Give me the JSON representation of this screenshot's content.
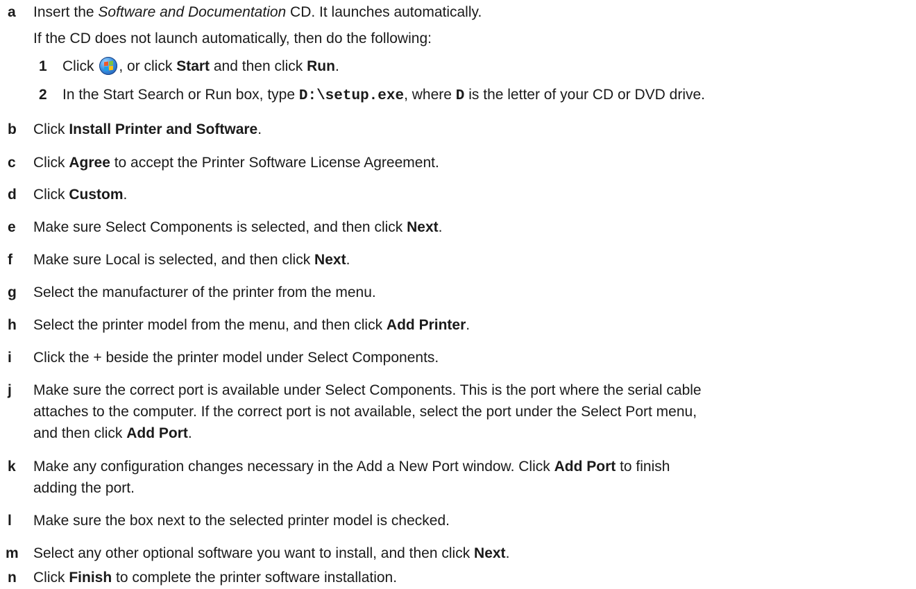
{
  "steps": {
    "a": {
      "letter": "a",
      "t1": "Insert the ",
      "t2": "Software and Documentation",
      "t3": " CD. It launches automatically.",
      "note": "If the CD does not launch automatically, then do the following:",
      "sub1": {
        "num": "1",
        "t1": "Click ",
        "t2": ", or click ",
        "b1": "Start",
        "t3": " and then click ",
        "b2": "Run",
        "t4": "."
      },
      "sub2": {
        "num": "2",
        "t1": "In the Start Search or Run box, type ",
        "code1": "D:\\setup.exe",
        "t2": ", where ",
        "code2": "D",
        "t3": " is the letter of your CD or DVD drive."
      }
    },
    "b": {
      "letter": "b",
      "t1": "Click ",
      "b1": "Install Printer and Software",
      "t2": "."
    },
    "c": {
      "letter": "c",
      "t1": "Click ",
      "b1": "Agree",
      "t2": " to accept the Printer Software License Agreement."
    },
    "d": {
      "letter": "d",
      "t1": "Click ",
      "b1": "Custom",
      "t2": "."
    },
    "e": {
      "letter": "e",
      "t1": "Make sure Select Components is selected, and then click ",
      "b1": "Next",
      "t2": "."
    },
    "f": {
      "letter": "f",
      "t1": "Make sure Local is selected, and then click ",
      "b1": "Next",
      "t2": "."
    },
    "g": {
      "letter": "g",
      "t1": "Select the manufacturer of the printer from the menu."
    },
    "h": {
      "letter": "h",
      "t1": "Select the printer model from the menu, and then click ",
      "b1": "Add Printer",
      "t2": "."
    },
    "i": {
      "letter": "i",
      "t1": "Click the + beside the printer model under Select Components."
    },
    "j": {
      "letter": "j",
      "line1": "Make sure the correct port is available under Select Components. This is the port where the serial cable",
      "line2": "attaches to the computer. If the correct port is not available, select the port under the Select Port menu,",
      "line3a": "and then click ",
      "b1": "Add Port",
      "line3b": "."
    },
    "k": {
      "letter": "k",
      "t1": "Make any configuration changes necessary in the Add a New Port window. Click ",
      "b1": "Add Port",
      "t2": " to finish",
      "line2": "adding the port."
    },
    "l": {
      "letter": "l",
      "t1": "Make sure the box next to the selected printer model is checked."
    },
    "m": {
      "letter": "m",
      "t1": "Select any other optional software you want to install, and then click ",
      "b1": "Next",
      "t2": "."
    },
    "n": {
      "letter": "n",
      "t1": "Click ",
      "b1": "Finish",
      "t2": " to complete the printer software installation."
    }
  },
  "icons": {
    "start_orb": "windows-start-orb-icon"
  }
}
